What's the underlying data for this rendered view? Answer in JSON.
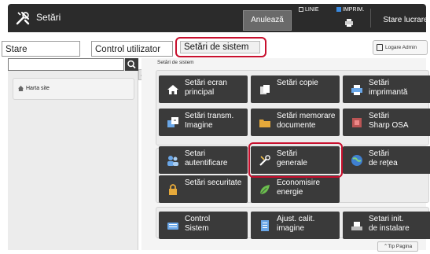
{
  "header": {
    "title": "Setări",
    "cancel_label": "Anulează",
    "status_line": "LINIE",
    "status_print": "IMPRIM.",
    "job_status_label": "Stare lucrare"
  },
  "tabs": {
    "stare": "Stare",
    "control_user": "Control utilizator",
    "system": "Setări de sistem",
    "logout": "Logare Admin"
  },
  "sidebar": {
    "search": {
      "placeholder": "",
      "value": ""
    },
    "sitemap_label": "Harta site"
  },
  "breadcrumb": "Setări de sistem",
  "tiles": [
    {
      "id": "screen",
      "label": "Setări ecran\nprincipal",
      "icon": "home-icon"
    },
    {
      "id": "copy",
      "label": "Setări copie",
      "icon": "copy-icon"
    },
    {
      "id": "printer",
      "label": "Setări\nimprimantă",
      "icon": "printer-icon"
    },
    {
      "id": "transmit",
      "label": "Setări transm.\nImagine",
      "icon": "image-send-icon"
    },
    {
      "id": "docstore",
      "label": "Setări memorare\ndocumente",
      "icon": "folder-icon"
    },
    {
      "id": "osa",
      "label": "Setări\nSharp OSA",
      "icon": "osa-icon"
    },
    {
      "id": "auth",
      "label": "Setari\nautentificare",
      "icon": "users-icon"
    },
    {
      "id": "general",
      "label": "Setări\ngenerale",
      "icon": "tools-icon"
    },
    {
      "id": "network",
      "label": "Setări\nde rețea",
      "icon": "globe-icon"
    },
    {
      "id": "security",
      "label": "Setări securitate",
      "icon": "lock-icon"
    },
    {
      "id": "energy",
      "label": "Economisire\nenergie",
      "icon": "leaf-icon"
    },
    {
      "id": "sysctl",
      "label": "Control\nSistem",
      "icon": "keyboard-icon"
    },
    {
      "id": "quality",
      "label": "Ajust. calit.\nimagine",
      "icon": "document-icon"
    },
    {
      "id": "install",
      "label": "Setari init.\nde instalare",
      "icon": "install-icon"
    }
  ],
  "tip_label": "Tip Pagina",
  "colors": {
    "accent_red": "#c8102e",
    "tile_bg": "#3a3a3a",
    "topbar_bg": "#2b2b2b"
  }
}
